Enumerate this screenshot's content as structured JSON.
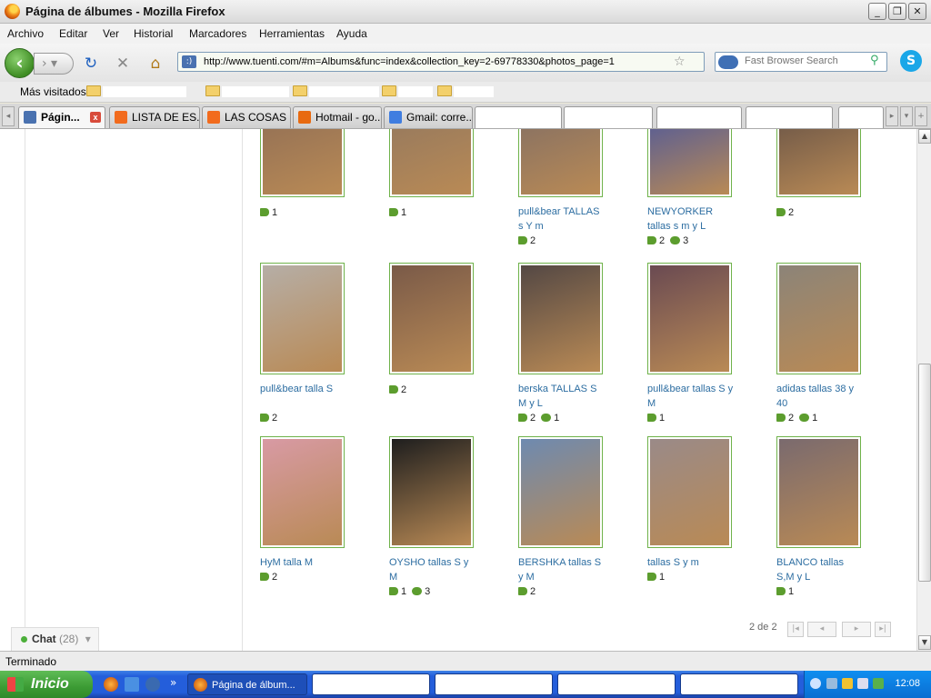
{
  "window": {
    "title": "Página de álbumes - Mozilla Firefox",
    "min": "_",
    "max": "❐",
    "close": "✕"
  },
  "menu": [
    "Archivo",
    "Editar",
    "Ver",
    "Historial",
    "Marcadores",
    "Herramientas",
    "Ayuda"
  ],
  "nav": {
    "url": "http://www.tuenti.com/#m=Albums&func=index&collection_key=2-69778330&photos_page=1",
    "search_placeholder": "Fast Browser Search",
    "back_glyph": "‹",
    "fwd_glyph": "›  ▾",
    "reload_glyph": "↻",
    "stop_glyph": "✕",
    "home_glyph": "⌂",
    "star_glyph": "☆",
    "url_icon_text": ":)",
    "search_glyph": "⚲",
    "skype_glyph": "S"
  },
  "bookmarks": {
    "most_visited": "Más visitados"
  },
  "tabs": [
    {
      "label": "Págin...",
      "active": true,
      "fav_color": "#4a72b0"
    },
    {
      "label": "LISTA DE ES...",
      "active": false,
      "fav_color": "#f26b1d"
    },
    {
      "label": "LAS COSAS ...",
      "active": false,
      "fav_color": "#f26b1d"
    },
    {
      "label": "Hotmail - go...",
      "active": false,
      "fav_color": "#e86a10"
    },
    {
      "label": "Gmail: corre...",
      "active": false,
      "fav_color": "#3f7de0"
    },
    {
      "label": "",
      "active": false,
      "fav_color": ""
    },
    {
      "label": "",
      "active": false,
      "fav_color": ""
    },
    {
      "label": "",
      "active": false,
      "fav_color": ""
    },
    {
      "label": "",
      "active": false,
      "fav_color": ""
    },
    {
      "label": "",
      "active": false,
      "fav_color": ""
    }
  ],
  "tab_close": "x",
  "photos": [
    {
      "caption": "",
      "tags": "1",
      "comments": "",
      "color": "#8a6a55"
    },
    {
      "caption": "",
      "tags": "1",
      "comments": "",
      "color": "#8d7560"
    },
    {
      "caption": "pull&bear TALLAS s Y m",
      "tags": "2",
      "comments": "",
      "color": "#7a6a66"
    },
    {
      "caption": "NEWYORKER tallas s m y L",
      "tags": "2",
      "comments": "3",
      "color": "#3a4fa8"
    },
    {
      "caption": "",
      "tags": "2",
      "comments": "",
      "color": "#5a4a44"
    },
    {
      "caption": "pull&bear talla S",
      "tags": "2",
      "comments": "",
      "color": "#b6aea6"
    },
    {
      "caption": "",
      "tags": "2",
      "comments": "",
      "color": "#7a5a48"
    },
    {
      "caption": "berska TALLAS S M y L",
      "tags": "2",
      "comments": "1",
      "color": "#544844"
    },
    {
      "caption": "pull&bear tallas S y M",
      "tags": "1",
      "comments": "",
      "color": "#6a4a52"
    },
    {
      "caption": "adidas tallas 38 y 40",
      "tags": "2",
      "comments": "1",
      "color": "#8c8478"
    },
    {
      "caption": "HyM talla M",
      "tags": "2",
      "comments": "",
      "color": "#d89aa4"
    },
    {
      "caption": "OYSHO tallas S y M",
      "tags": "1",
      "comments": "3",
      "color": "#1e1e1e"
    },
    {
      "caption": "BERSHKA tallas S y M",
      "tags": "2",
      "comments": "",
      "color": "#6e8ab0"
    },
    {
      "caption": "tallas S y m",
      "tags": "1",
      "comments": "",
      "color": "#9a8a88"
    },
    {
      "caption": "BLANCO tallas S,M y L",
      "tags": "1",
      "comments": "",
      "color": "#7a6a6e"
    }
  ],
  "pager": {
    "label": "2 de 2",
    "first": "|◂",
    "prev": "◂",
    "next": "▸",
    "last": "▸|"
  },
  "chat": {
    "label": "Chat",
    "count": "(28)",
    "arrow": "▾"
  },
  "status": "Terminado",
  "scroll": {
    "up": "▲",
    "down": "▼"
  },
  "taskbar": {
    "start": "Inicio",
    "more": "»",
    "active_task": "Página de álbum...",
    "clock": "12:08"
  }
}
